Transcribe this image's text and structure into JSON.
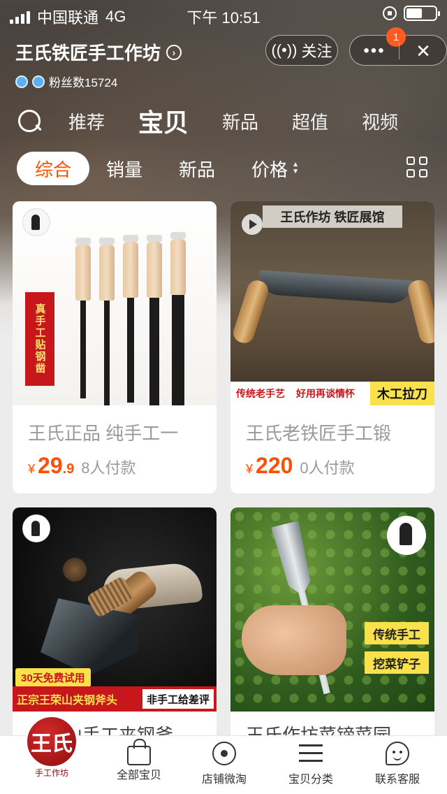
{
  "status_bar": {
    "carrier": "中国联通",
    "network": "4G",
    "time": "下午 10:51"
  },
  "shop": {
    "name": "王氏铁匠手工作坊",
    "fans_label": "粉丝数15724",
    "follow_label": "关注",
    "notification_count": "1",
    "more_label": "•••",
    "close_label": "✕"
  },
  "tabs": {
    "items": [
      "推荐",
      "宝贝",
      "新品",
      "超值",
      "视频"
    ],
    "active": "宝贝"
  },
  "filters": {
    "items": [
      "综合",
      "销量",
      "新品",
      "价格"
    ],
    "active": "综合"
  },
  "products": [
    {
      "title": "王氏正品 纯手工一",
      "currency": "¥",
      "price_int": "29",
      "price_dec": ".9",
      "sold": "8人付款",
      "image_text": {
        "label": "真手工贴钢凿"
      }
    },
    {
      "title": "王氏老铁匠手工锻",
      "currency": "¥",
      "price_int": "220",
      "price_dec": "",
      "sold": "0人付款",
      "image_text": {
        "banner": "王氏作坊 铁匠展馆",
        "strip_a": "传统老手艺",
        "strip_b": "好用再谈情怀",
        "strip_c": "木工拉刀"
      }
    },
    {
      "title": "王荣山手工夹钢斧",
      "image_text": {
        "tag": "30天免费试用",
        "strip_a": "正宗王荣山夹钢斧头",
        "strip_b": "非手工给差评"
      }
    },
    {
      "title": "王氏作坊菜镑菜园",
      "image_text": {
        "tag_a": "传统手工",
        "tag_b": "挖菜铲子"
      }
    }
  ],
  "bottom_nav": {
    "logo_text": "王氏",
    "logo_caption": "手工作坊",
    "items": [
      "全部宝贝",
      "店铺微淘",
      "宝贝分类",
      "联系客服"
    ]
  },
  "colors": {
    "accent": "#ff5000",
    "label_red": "#c8161d",
    "tag_yellow": "#f8e14a"
  }
}
